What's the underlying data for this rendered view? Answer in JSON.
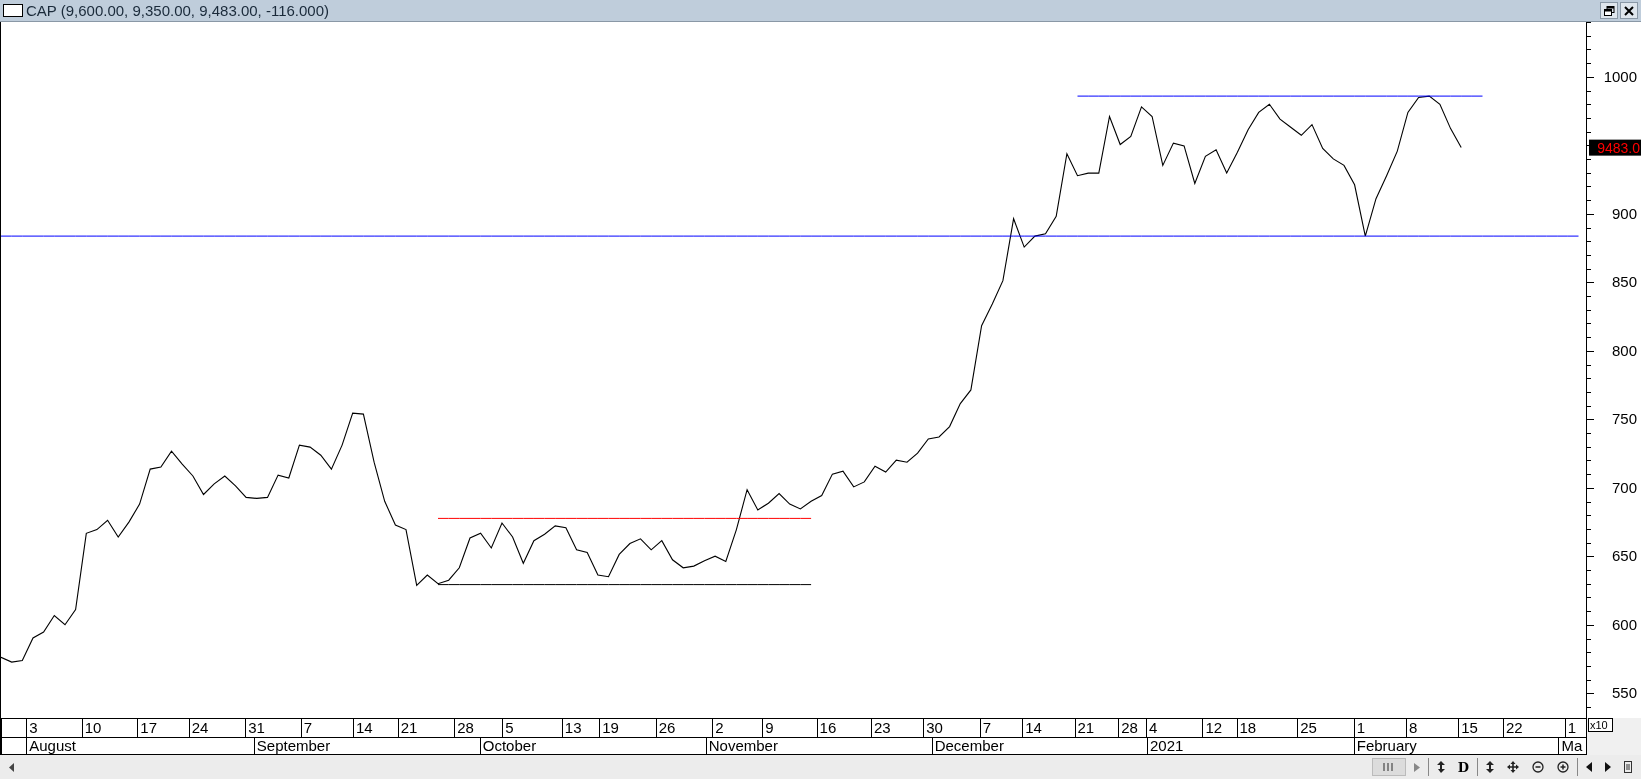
{
  "window": {
    "title": "CAP (9,600.00, 9,350.00, 9,483.00, -116.000)"
  },
  "chart": {
    "chart_data": {
      "type": "line",
      "ylim": [
        532,
        1040
      ],
      "yticks": [
        550,
        600,
        650,
        700,
        750,
        800,
        850,
        900,
        1000
      ],
      "series": [
        {
          "color": "#000000",
          "values": [
            576.3,
            572.8,
            574.0,
            590.5,
            594.7,
            606.8,
            600.1,
            611.2,
            666.8,
            669.5,
            676.3,
            664.1,
            675.0,
            688.1,
            713.7,
            715.1,
            726.8,
            717.3,
            708.6,
            695.1,
            702.9,
            708.6,
            701.4,
            693.0,
            692.3,
            693.0,
            709.3,
            707.2,
            731.2,
            729.7,
            723.8,
            713.7,
            731.2,
            754.5,
            753.8,
            718.7,
            690.2,
            672.9,
            669.5,
            628.8,
            636.4,
            630.0,
            632.6,
            641.6,
            663.4,
            666.8,
            656.1,
            674.3,
            664.1,
            644.9,
            661.4,
            666.1,
            672.2,
            670.9,
            654.8,
            652.8,
            636.4,
            635.1,
            651.4,
            659.4,
            662.8,
            654.8,
            661.4,
            647.5,
            641.6,
            642.9,
            646.8,
            650.1,
            646.2,
            669.5,
            698.6,
            683.9,
            688.8,
            695.8,
            688.1,
            684.6,
            690.2,
            694.4,
            710.0,
            712.2,
            700.7,
            704.3,
            715.8,
            711.5,
            720.2,
            718.7,
            725.3,
            735.7,
            737.1,
            744.7,
            761.5,
            771.5,
            818.3,
            834.1,
            851.2,
            896.4,
            875.7,
            883.7,
            885.5,
            898.2,
            943.9,
            927.8,
            929.7,
            929.7,
            971.0,
            950.6,
            956.4,
            978.0,
            971.0,
            935.3,
            951.6,
            949.6,
            922.1,
            942.0,
            946.8,
            929.7,
            944.9,
            961.3,
            974.0,
            979.9,
            969.1,
            963.2,
            957.3,
            965.1,
            947.7,
            940.1,
            935.3,
            921.2,
            883.7,
            911.0,
            927.8,
            945.8,
            974.0,
            984.9,
            985.9,
            979.9,
            962.2,
            948.3,
            null,
            null,
            null,
            null,
            null,
            null,
            null,
            null,
            null,
            null,
            null
          ]
        },
        {
          "color": "#0000ff",
          "values": [
            null,
            null,
            null,
            null,
            null,
            null,
            null,
            null,
            null,
            null,
            null,
            null,
            null,
            null,
            null,
            null,
            null,
            null,
            null,
            null,
            null,
            null,
            null,
            null,
            null,
            null,
            null,
            null,
            null,
            null,
            null,
            null,
            null,
            null,
            null,
            null,
            null,
            null,
            null,
            null,
            null,
            null,
            null,
            null,
            null,
            null,
            null,
            null,
            null,
            null,
            null,
            null,
            null,
            null,
            null,
            null,
            null,
            null,
            null,
            null,
            null,
            null,
            null,
            null,
            null,
            null,
            null,
            null,
            null,
            null,
            null,
            null,
            null,
            null,
            null,
            null,
            null,
            null,
            null,
            null,
            null,
            null,
            null,
            null,
            null,
            null,
            null,
            null,
            null,
            null,
            null,
            null,
            null,
            null,
            null,
            null,
            null,
            null,
            null,
            null,
            null,
            985.9,
            985.9,
            985.9,
            985.9,
            985.9,
            985.9,
            985.9,
            985.9,
            985.9,
            985.9,
            985.9,
            985.9,
            985.9,
            985.9,
            985.9,
            985.9,
            985.9,
            985.9,
            985.9,
            985.9,
            985.9,
            985.9,
            985.9,
            985.9,
            985.9,
            985.9,
            985.9,
            985.9,
            985.9,
            985.9,
            985.9,
            985.9,
            985.9,
            985.9,
            985.9,
            985.9,
            985.9,
            985.9,
            985.9,
            null,
            null,
            null,
            null,
            null,
            null,
            null,
            null,
            null
          ]
        },
        {
          "color": "#ff0000",
          "values": [
            null,
            null,
            null,
            null,
            null,
            null,
            null,
            null,
            null,
            null,
            null,
            null,
            null,
            null,
            null,
            null,
            null,
            null,
            null,
            null,
            null,
            null,
            null,
            null,
            null,
            null,
            null,
            null,
            null,
            null,
            null,
            null,
            null,
            null,
            null,
            null,
            null,
            null,
            null,
            null,
            null,
            677.7,
            677.7,
            677.7,
            677.7,
            677.7,
            677.7,
            677.7,
            677.7,
            677.7,
            677.7,
            677.7,
            677.7,
            677.7,
            677.7,
            677.7,
            677.7,
            677.7,
            677.7,
            677.7,
            677.7,
            677.7,
            677.7,
            677.7,
            677.7,
            677.7,
            677.7,
            677.7,
            677.7,
            677.7,
            677.7,
            677.7,
            677.7,
            677.7,
            677.7,
            677.7,
            677.7,
            null,
            null,
            null,
            null,
            null,
            null,
            null,
            null,
            null,
            null,
            null,
            null,
            null,
            null,
            null,
            null,
            null,
            null,
            null,
            null,
            null,
            null,
            null,
            null,
            null,
            null,
            null,
            null,
            null,
            null,
            null,
            null,
            null,
            null,
            null,
            null,
            null,
            null,
            null,
            null,
            null,
            null,
            null,
            null,
            null,
            null,
            null,
            null,
            null,
            null,
            null,
            null,
            null,
            null,
            null,
            null,
            null,
            null,
            null,
            null,
            null,
            null,
            null,
            null,
            null,
            null,
            null,
            null,
            null,
            null,
            null,
            null
          ]
        },
        {
          "color": "#000000",
          "values": [
            null,
            null,
            null,
            null,
            null,
            null,
            null,
            null,
            null,
            null,
            null,
            null,
            null,
            null,
            null,
            null,
            null,
            null,
            null,
            null,
            null,
            null,
            null,
            null,
            null,
            null,
            null,
            null,
            null,
            null,
            null,
            null,
            null,
            null,
            null,
            null,
            null,
            null,
            null,
            null,
            null,
            629.4,
            629.4,
            629.4,
            629.4,
            629.4,
            629.4,
            629.4,
            629.4,
            629.4,
            629.4,
            629.4,
            629.4,
            629.4,
            629.4,
            629.4,
            629.4,
            629.4,
            629.4,
            629.4,
            629.4,
            629.4,
            629.4,
            629.4,
            629.4,
            629.4,
            629.4,
            629.4,
            629.4,
            629.4,
            629.4,
            629.4,
            629.4,
            629.4,
            629.4,
            629.4,
            629.4,
            null,
            null,
            null,
            null,
            null,
            null,
            null,
            null,
            null,
            null,
            null,
            null,
            null,
            null,
            null,
            null,
            null,
            null,
            null,
            null,
            null,
            null,
            null,
            null,
            null,
            null,
            null,
            null,
            null,
            null,
            null,
            null,
            null,
            null,
            null,
            null,
            null,
            null,
            null,
            null,
            null,
            null,
            null,
            null,
            null,
            null,
            null,
            null,
            null,
            null,
            null,
            null,
            null,
            null,
            null,
            null,
            null,
            null,
            null,
            null,
            null,
            null,
            null,
            null,
            null,
            null,
            null,
            null,
            null,
            null,
            null,
            null
          ]
        },
        {
          "color": "#0000ff",
          "values": [
            883.7,
            883.7,
            883.7,
            883.7,
            883.7,
            883.7,
            883.7,
            883.7,
            883.7,
            883.7,
            883.7,
            883.7,
            883.7,
            883.7,
            883.7,
            883.7,
            883.7,
            883.7,
            883.7,
            883.7,
            883.7,
            883.7,
            883.7,
            883.7,
            883.7,
            883.7,
            883.7,
            883.7,
            883.7,
            883.7,
            883.7,
            883.7,
            883.7,
            883.7,
            883.7,
            883.7,
            883.7,
            883.7,
            883.7,
            883.7,
            883.7,
            883.7,
            883.7,
            883.7,
            883.7,
            883.7,
            883.7,
            883.7,
            883.7,
            883.7,
            883.7,
            883.7,
            883.7,
            883.7,
            883.7,
            883.7,
            883.7,
            883.7,
            883.7,
            883.7,
            883.7,
            883.7,
            883.7,
            883.7,
            883.7,
            883.7,
            883.7,
            883.7,
            883.7,
            883.7,
            883.7,
            883.7,
            883.7,
            883.7,
            883.7,
            883.7,
            883.7,
            883.7,
            883.7,
            883.7,
            883.7,
            883.7,
            883.7,
            883.7,
            883.7,
            883.7,
            883.7,
            883.7,
            883.7,
            883.7,
            883.7,
            883.7,
            883.7,
            883.7,
            883.7,
            883.7,
            883.7,
            883.7,
            883.7,
            883.7,
            883.7,
            883.7,
            883.7,
            883.7,
            883.7,
            883.7,
            883.7,
            883.7,
            883.7,
            883.7,
            883.7,
            883.7,
            883.7,
            883.7,
            883.7,
            883.7,
            883.7,
            883.7,
            883.7,
            883.7,
            883.7,
            883.7,
            883.7,
            883.7,
            883.7,
            883.7,
            883.7,
            883.7,
            883.7,
            883.7,
            883.7,
            883.7,
            883.7,
            883.7,
            883.7,
            883.7,
            883.7,
            883.7,
            883.7,
            883.7,
            883.7,
            883.7,
            883.7,
            883.7,
            883.7,
            883.7,
            883.7,
            883.7,
            883.7
          ]
        }
      ]
    },
    "day_labels": [
      "3",
      "10",
      "17",
      "24",
      "31",
      "7",
      "14",
      "21",
      "28",
      "5",
      "13",
      "19",
      "26",
      "2",
      "9",
      "16",
      "23",
      "30",
      "7",
      "14",
      "21",
      "28",
      "4",
      "12",
      "18",
      "25",
      "1",
      "8",
      "15",
      "22",
      "1"
    ],
    "month_labels": [
      "August",
      "September",
      "October",
      "November",
      "December",
      "2021",
      "February",
      "Ma"
    ],
    "price_tag": "9483.0",
    "scale_factor": "x10"
  },
  "scroll_toolbar": {
    "label_button": "D"
  }
}
